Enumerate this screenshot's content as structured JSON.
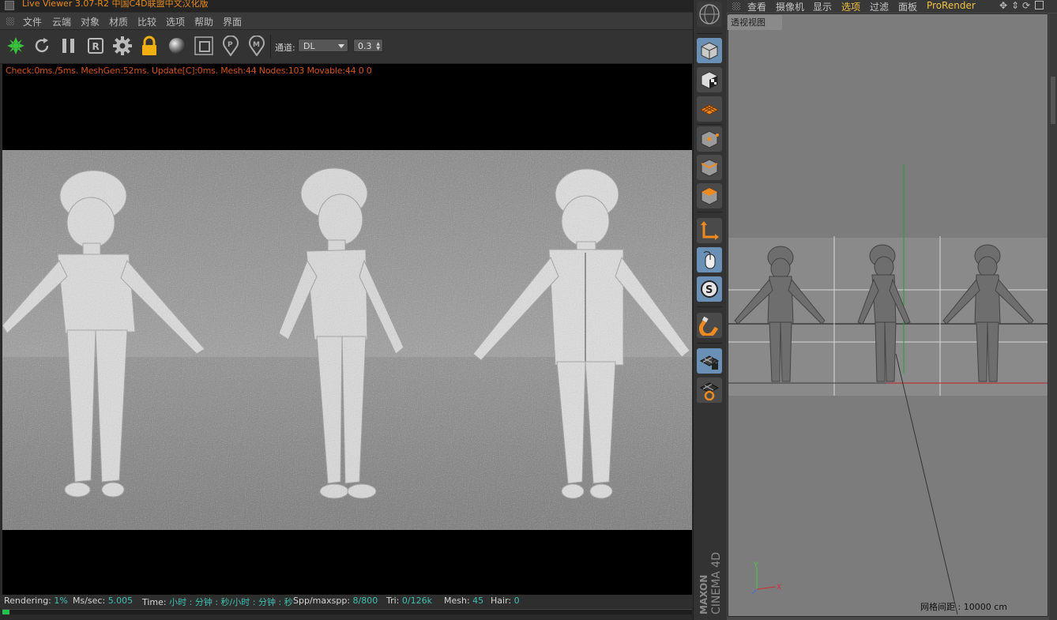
{
  "app_title": "Live Viewer 3.07-R2 中国C4D联盟中文汉化版",
  "live_viewer": {
    "menu": [
      "文件",
      "云端",
      "对象",
      "材质",
      "比较",
      "选项",
      "帮助",
      "界面"
    ],
    "toolbar": {
      "icons": [
        "render-start-icon",
        "refresh-icon",
        "pause-icon",
        "region-render-icon",
        "settings-gear-icon",
        "lock-icon",
        "material-sphere-icon",
        "region-frame-icon",
        "pin-p-icon",
        "pin-m-icon"
      ],
      "channel_label": "通道:",
      "channel_value": "DL",
      "spin_value": "0.3"
    },
    "stats_line": "Check:0ms./5ms. MeshGen:52ms. Update[C]:0ms. Mesh:44 Nodes:103 Movable:44  0 0",
    "status": {
      "rendering_label": "Rendering:",
      "rendering_value": "1%",
      "ms_label": "Ms/sec:",
      "ms_value": "5.005",
      "time_label": "Time:",
      "time_value": "小时 : 分钟 : 秒/小时 : 分钟 : 秒",
      "spp_label": "Spp/maxspp:",
      "spp_value": "8/800",
      "tri_label": "Tri:",
      "tri_value": "0/126k",
      "mesh_label": "Mesh:",
      "mesh_value": "45",
      "hair_label": "Hair:",
      "hair_value": "0"
    },
    "progress_fraction": 0.01
  },
  "palette": {
    "buttons": [
      "model-mode-icon",
      "texture-mode-icon",
      "workplane-icon",
      "points-mode-icon",
      "edges-mode-icon",
      "polygons-mode-icon",
      "axis-mode-icon",
      "tweak-mouse-icon",
      "snap-s-icon",
      "magnet-icon",
      "lock-workplane-icon",
      "workplane-snap-icon"
    ],
    "brand_line1": "MAXON",
    "brand_line2": "CINEMA 4D"
  },
  "viewport": {
    "menu": [
      "查看",
      "摄像机",
      "显示",
      "选项",
      "过滤",
      "面板",
      "ProRender"
    ],
    "label": "透视视图",
    "grid_spacing": "网格间距 : 10000 cm",
    "axis_y": "Y",
    "axis_x": "X",
    "colors": {
      "accent_text": "#f0c040",
      "y_axis": "#3fcf3f",
      "x_axis": "#d03030"
    }
  }
}
